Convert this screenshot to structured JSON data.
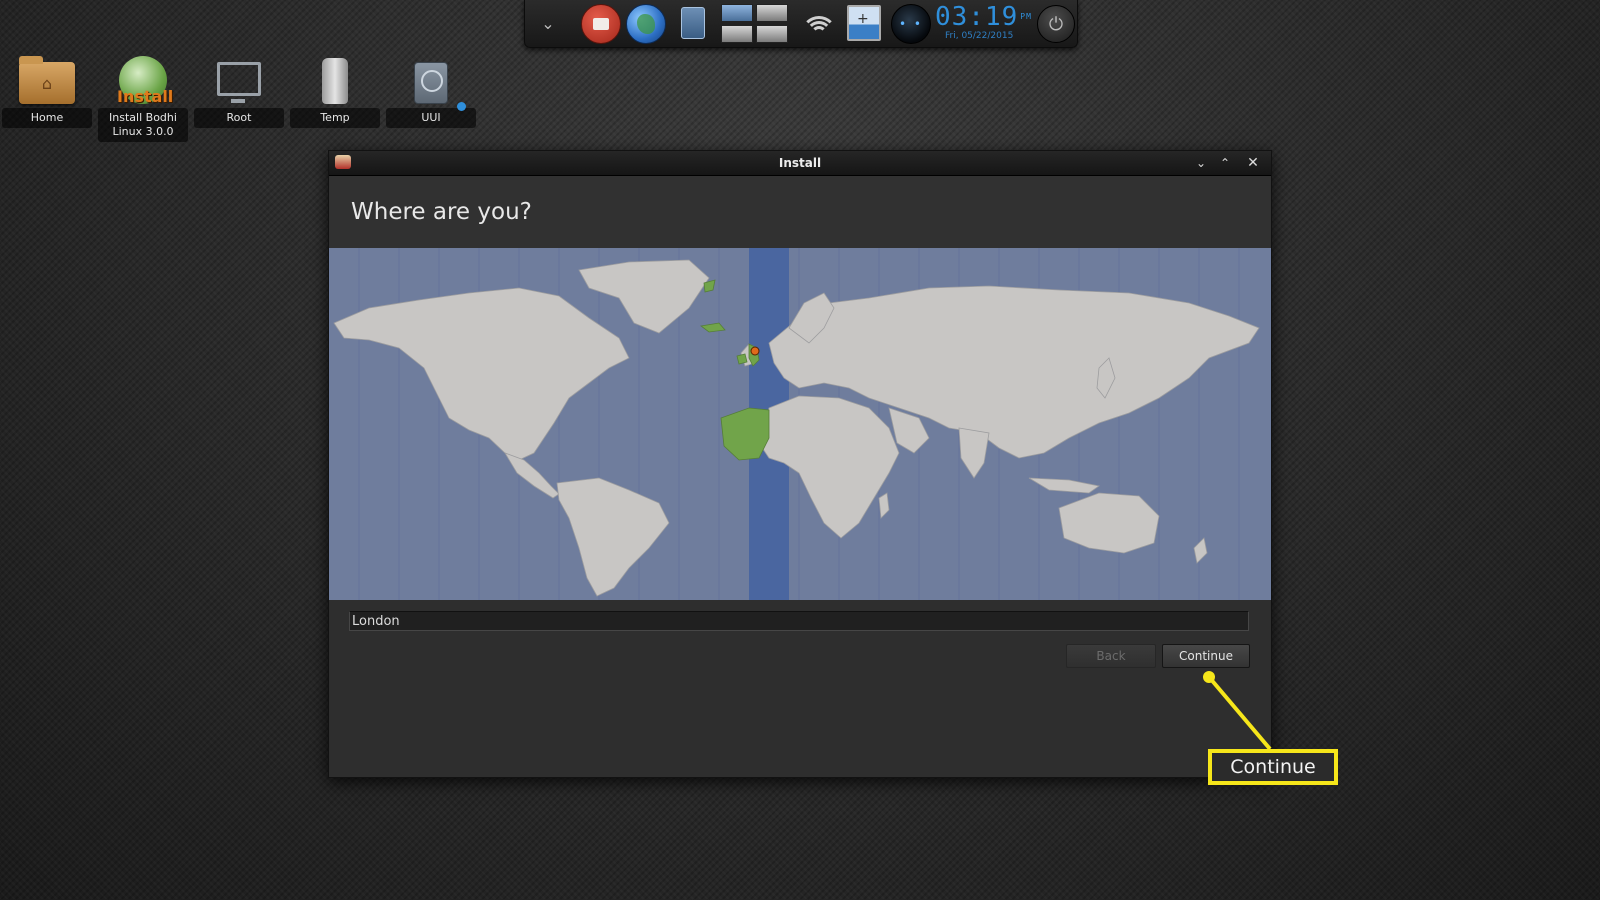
{
  "panel": {
    "clock_time": "03:19",
    "clock_ampm": "PM",
    "clock_date": "Fri, 05/22/2015"
  },
  "desktop": {
    "icons": [
      {
        "label": "Home",
        "icon": "folder-home-icon"
      },
      {
        "label": "Install Bodhi Linux 3.0.0",
        "icon": "install-leaf-icon",
        "overlay": "Install"
      },
      {
        "label": "Root",
        "icon": "monitor-icon"
      },
      {
        "label": "Temp",
        "icon": "trash-vase-icon"
      },
      {
        "label": "UUI",
        "icon": "drive-icon"
      }
    ]
  },
  "window": {
    "title": "Install",
    "heading": "Where are you?",
    "timezone_value": "London",
    "selected_region": "London",
    "back_label": "Back",
    "continue_label": "Continue"
  },
  "annotation": {
    "label": "Continue",
    "color": "#f6e61a"
  },
  "colors": {
    "map_ocean": "#6f7d9d",
    "map_land": "#c8c6c4",
    "map_selected_zone": "#4a66a0",
    "map_highlight_land": "#71a44a",
    "clock": "#2f8fdb"
  }
}
